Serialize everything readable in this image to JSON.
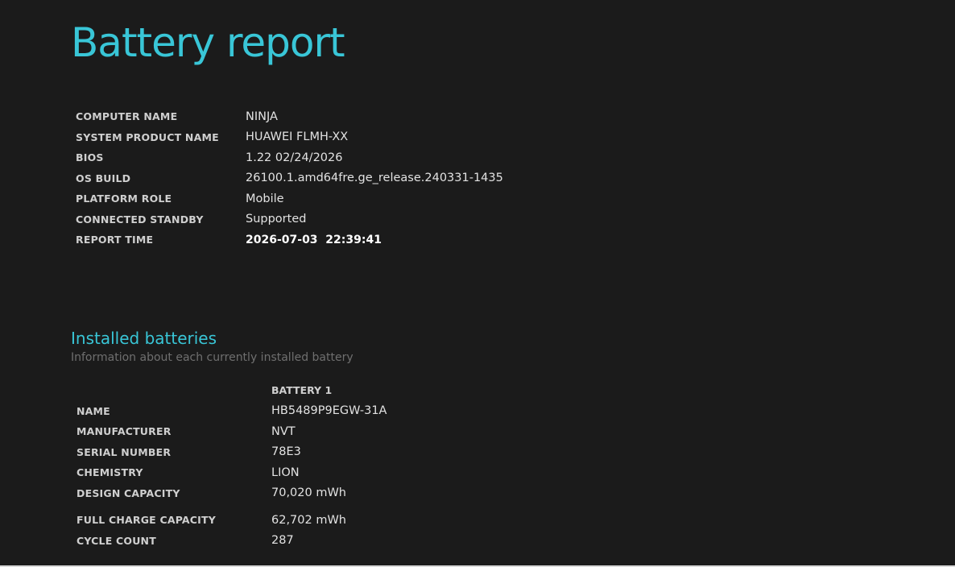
{
  "title": "Battery report",
  "system_info": {
    "rows": [
      {
        "label": "COMPUTER NAME",
        "value": "NINJA"
      },
      {
        "label": "SYSTEM PRODUCT NAME",
        "value": "HUAWEI FLMH-XX"
      },
      {
        "label": "BIOS",
        "value": "1.22 02/24/2026"
      },
      {
        "label": "OS BUILD",
        "value": "26100.1.amd64fre.ge_release.240331-1435"
      },
      {
        "label": "PLATFORM ROLE",
        "value": "Mobile"
      },
      {
        "label": "CONNECTED STANDBY",
        "value": "Supported"
      },
      {
        "label": "REPORT TIME",
        "value": "2026-07-03  22:39:41"
      }
    ]
  },
  "installed_batteries": {
    "heading": "Installed batteries",
    "subtitle": "Information about each currently installed battery",
    "column_header": "BATTERY 1",
    "rows": [
      {
        "label": "NAME",
        "value": "HB5489P9EGW-31A"
      },
      {
        "label": "MANUFACTURER",
        "value": "NVT"
      },
      {
        "label": "SERIAL NUMBER",
        "value": "78E3"
      },
      {
        "label": "CHEMISTRY",
        "value": "LION"
      },
      {
        "label": "DESIGN CAPACITY",
        "value": "70,020 mWh"
      },
      {
        "label": "FULL CHARGE CAPACITY",
        "value": "62,702 mWh"
      },
      {
        "label": "CYCLE COUNT",
        "value": "287"
      }
    ]
  },
  "colors": {
    "background": "#1b1b1b",
    "accent": "#39c6d7",
    "text": "#e6e6e6",
    "muted": "#6f6f6f"
  }
}
